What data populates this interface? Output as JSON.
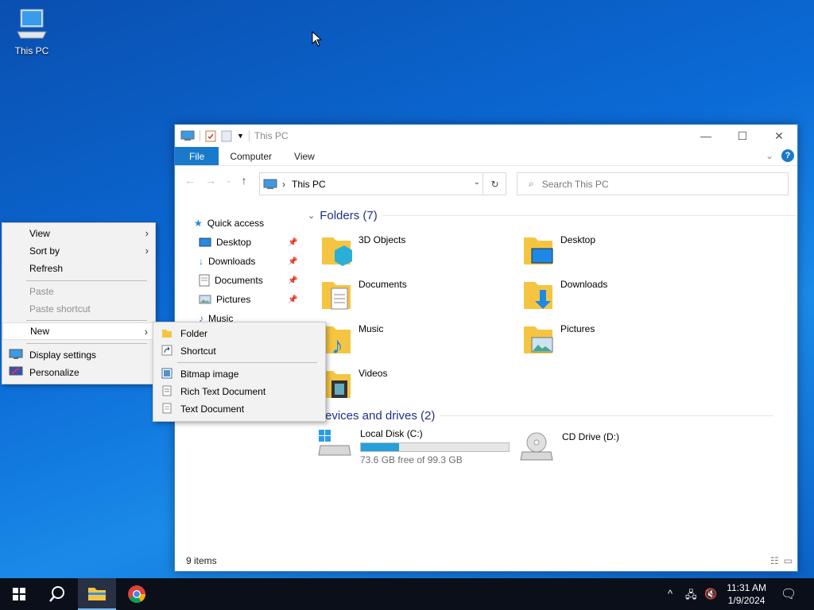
{
  "desktop": {
    "this_pc_label": "This PC"
  },
  "window": {
    "title": "This PC",
    "ribbon_tabs": [
      "File",
      "Computer",
      "View"
    ],
    "address": "This PC",
    "search_placeholder": "Search This PC",
    "status": "9 items",
    "nav": {
      "quick_access": "Quick access",
      "items": [
        "Desktop",
        "Downloads",
        "Documents",
        "Pictures",
        "Music"
      ]
    },
    "folders_header": "Folders (7)",
    "folders": [
      "3D Objects",
      "Desktop",
      "Documents",
      "Downloads",
      "Music",
      "Pictures",
      "Videos"
    ],
    "drives_header": "evices and drives (2)",
    "drives": [
      {
        "name": "Local Disk (C:)",
        "free": "73.6 GB free of 99.3 GB",
        "used_fraction": 0.26
      },
      {
        "name": "CD Drive (D:)"
      }
    ]
  },
  "context_menu": {
    "items": [
      {
        "label": "View",
        "submenu": true
      },
      {
        "label": "Sort by",
        "submenu": true
      },
      {
        "label": "Refresh"
      },
      {
        "label": "Paste",
        "disabled": true
      },
      {
        "label": "Paste shortcut",
        "disabled": true
      },
      {
        "label": "New",
        "submenu": true,
        "highlighted": true
      },
      {
        "label": "Display settings",
        "icon": "display-icon"
      },
      {
        "label": "Personalize",
        "icon": "personalize-icon"
      }
    ]
  },
  "new_submenu": {
    "items": [
      {
        "label": "Folder",
        "icon": "folder-icon"
      },
      {
        "label": "Shortcut",
        "icon": "shortcut-icon"
      },
      {
        "label": "Bitmap image",
        "icon": "bitmap-icon"
      },
      {
        "label": "Rich Text Document",
        "icon": "rtf-icon"
      },
      {
        "label": "Text Document",
        "icon": "text-document-icon"
      }
    ]
  },
  "taskbar": {
    "time": "11:31 AM",
    "date": "1/9/2024"
  },
  "colors": {
    "accent": "#1979ca",
    "desktop": "#0b6bd6",
    "taskbar": "#0b0f1a",
    "disk_bar": "#26a0da"
  }
}
